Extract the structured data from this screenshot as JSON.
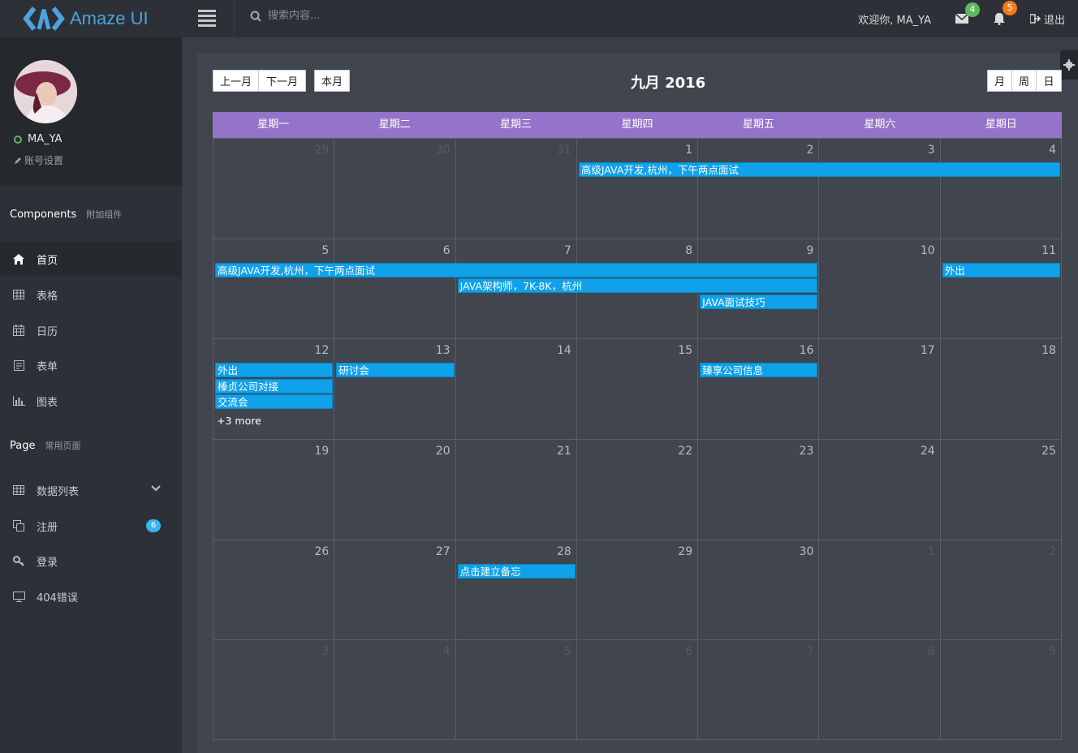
{
  "header": {
    "logo_text": "Amaze UI",
    "search_placeholder": "搜索内容...",
    "welcome": "欢迎你, MA_YA",
    "mail_count": "4",
    "notify_count": "5",
    "logout": "退出",
    "colors": {
      "mail_badge": "#5eb95e",
      "notify_badge": "#f37b1d"
    }
  },
  "sidebar": {
    "user_name": "MA_YA",
    "account_settings": "账号设置",
    "components_title": "Components",
    "components_sub": "附加组件",
    "items": [
      {
        "label": "首页",
        "icon": "home-icon"
      },
      {
        "label": "表格",
        "icon": "table-icon"
      },
      {
        "label": "日历",
        "icon": "calendar-icon"
      },
      {
        "label": "表单",
        "icon": "form-icon"
      },
      {
        "label": "图表",
        "icon": "chart-icon"
      }
    ],
    "page_title": "Page",
    "page_sub": "常用页面",
    "page_items": [
      {
        "label": "数据列表",
        "icon": "table-icon"
      },
      {
        "label": "注册",
        "icon": "copy-icon",
        "badge": "6"
      },
      {
        "label": "登录",
        "icon": "key-icon"
      },
      {
        "label": "404错误",
        "icon": "monitor-icon"
      }
    ]
  },
  "calendar": {
    "prev_month": "上一月",
    "next_month": "下一月",
    "this_month": "本月",
    "title": "九月 2016",
    "view_month": "月",
    "view_week": "周",
    "view_day": "日",
    "weekdays": [
      "星期一",
      "星期二",
      "星期三",
      "星期四",
      "星期五",
      "星期六",
      "星期日"
    ],
    "weeks": [
      [
        {
          "d": "29",
          "o": true
        },
        {
          "d": "30",
          "o": true
        },
        {
          "d": "31",
          "o": true
        },
        {
          "d": "1"
        },
        {
          "d": "2"
        },
        {
          "d": "3"
        },
        {
          "d": "4"
        }
      ],
      [
        {
          "d": "5"
        },
        {
          "d": "6"
        },
        {
          "d": "7"
        },
        {
          "d": "8"
        },
        {
          "d": "9"
        },
        {
          "d": "10"
        },
        {
          "d": "11"
        }
      ],
      [
        {
          "d": "12"
        },
        {
          "d": "13"
        },
        {
          "d": "14"
        },
        {
          "d": "15"
        },
        {
          "d": "16"
        },
        {
          "d": "17"
        },
        {
          "d": "18"
        }
      ],
      [
        {
          "d": "19"
        },
        {
          "d": "20"
        },
        {
          "d": "21"
        },
        {
          "d": "22"
        },
        {
          "d": "23"
        },
        {
          "d": "24"
        },
        {
          "d": "25"
        }
      ],
      [
        {
          "d": "26"
        },
        {
          "d": "27"
        },
        {
          "d": "28"
        },
        {
          "d": "29"
        },
        {
          "d": "30"
        },
        {
          "d": "1",
          "o": true
        },
        {
          "d": "2",
          "o": true
        }
      ],
      [
        {
          "d": "3",
          "o": true
        },
        {
          "d": "4",
          "o": true
        },
        {
          "d": "5",
          "o": true
        },
        {
          "d": "6",
          "o": true
        },
        {
          "d": "7",
          "o": true
        },
        {
          "d": "8",
          "o": true
        },
        {
          "d": "9",
          "o": true
        }
      ]
    ],
    "events": [
      {
        "title": "高级JAVA开发,杭州，下午两点面试",
        "week": 0,
        "start": 3,
        "end": 6,
        "row": 0
      },
      {
        "title": "高级JAVA开发,杭州，下午两点面试",
        "week": 1,
        "start": 0,
        "end": 4,
        "row": 0
      },
      {
        "title": "JAVA架构师，7K-8K，杭州",
        "week": 1,
        "start": 2,
        "end": 4,
        "row": 1
      },
      {
        "title": "JAVA面试技巧",
        "week": 1,
        "start": 4,
        "end": 4,
        "row": 2
      },
      {
        "title": "外出",
        "week": 1,
        "start": 6,
        "end": 6,
        "row": 0
      },
      {
        "title": "外出",
        "week": 2,
        "start": 0,
        "end": 0,
        "row": 0
      },
      {
        "title": "榛贞公司对接",
        "week": 2,
        "start": 0,
        "end": 0,
        "row": 1
      },
      {
        "title": "交流会",
        "week": 2,
        "start": 0,
        "end": 0,
        "row": 2
      },
      {
        "title": "研讨会",
        "week": 2,
        "start": 1,
        "end": 1,
        "row": 0
      },
      {
        "title": "臻享公司信息",
        "week": 2,
        "start": 4,
        "end": 4,
        "row": 0
      },
      {
        "title": "点击建立备忘",
        "week": 4,
        "start": 2,
        "end": 2,
        "row": 0
      }
    ],
    "more": {
      "label": "+3 more",
      "week": 2,
      "col": 0
    },
    "colors": {
      "header": "#9474c8",
      "event": "#0fa1ea"
    }
  }
}
